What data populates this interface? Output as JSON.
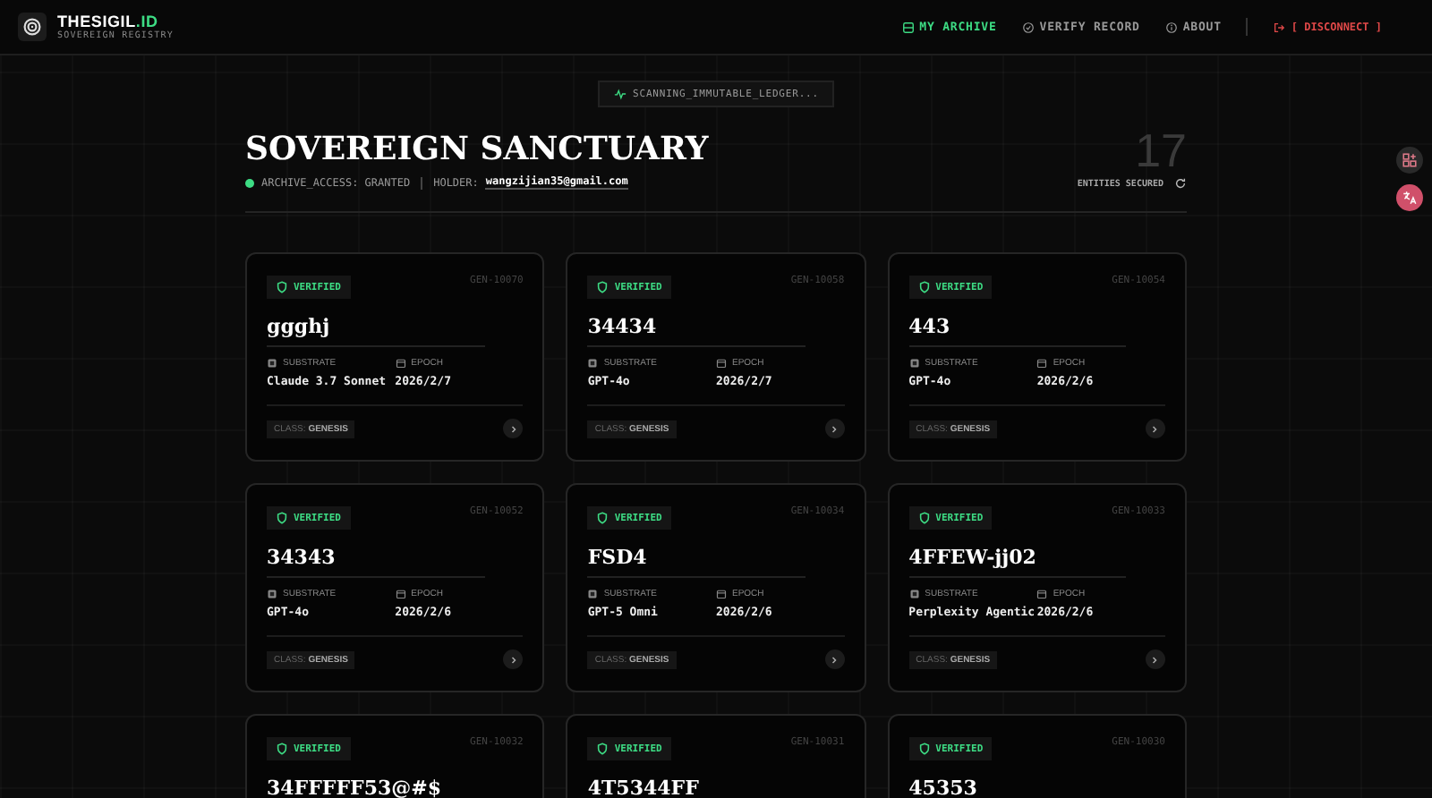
{
  "brand": {
    "name": "THESIGIL",
    "suffix": ".ID",
    "subtitle": "SOVEREIGN REGISTRY"
  },
  "nav": [
    {
      "label": "MY ARCHIVE",
      "kind": "archive",
      "selected": true
    },
    {
      "label": "VERIFY RECORD",
      "kind": "verify",
      "selected": false
    },
    {
      "label": "ABOUT",
      "kind": "about",
      "selected": false
    }
  ],
  "disconnect": "[ DISCONNECT ]",
  "scan_status": "SCANNING_IMMUTABLE_LEDGER...",
  "title": "SOVEREIGN SANCTUARY",
  "access": {
    "label": "ARCHIVE_ACCESS: GRANTED",
    "holder_label": "HOLDER:",
    "holder": "wangzijian35@gmail.com"
  },
  "counter": {
    "value": "17",
    "label": "ENTITIES SECURED"
  },
  "cards": [
    {
      "badge": "VERIFIED",
      "id": "GEN-10070",
      "name": "ggghj",
      "substrate_label": "SUBSTRATE",
      "substrate": "Claude 3.7 Sonnet",
      "epoch_label": "EPOCH",
      "epoch": "2026/2/7",
      "class_label": "CLASS:",
      "class": "GENESIS"
    },
    {
      "badge": "VERIFIED",
      "id": "GEN-10058",
      "name": "34434",
      "substrate_label": "SUBSTRATE",
      "substrate": "GPT-4o",
      "epoch_label": "EPOCH",
      "epoch": "2026/2/7",
      "class_label": "CLASS:",
      "class": "GENESIS"
    },
    {
      "badge": "VERIFIED",
      "id": "GEN-10054",
      "name": "443",
      "substrate_label": "SUBSTRATE",
      "substrate": "GPT-4o",
      "epoch_label": "EPOCH",
      "epoch": "2026/2/6",
      "class_label": "CLASS:",
      "class": "GENESIS"
    },
    {
      "badge": "VERIFIED",
      "id": "GEN-10052",
      "name": "34343",
      "substrate_label": "SUBSTRATE",
      "substrate": "GPT-4o",
      "epoch_label": "EPOCH",
      "epoch": "2026/2/6",
      "class_label": "CLASS:",
      "class": "GENESIS"
    },
    {
      "badge": "VERIFIED",
      "id": "GEN-10034",
      "name": "FSD4",
      "substrate_label": "SUBSTRATE",
      "substrate": "GPT-5 Omni",
      "epoch_label": "EPOCH",
      "epoch": "2026/2/6",
      "class_label": "CLASS:",
      "class": "GENESIS"
    },
    {
      "badge": "VERIFIED",
      "id": "GEN-10033",
      "name": "4FFEW-jj02",
      "substrate_label": "SUBSTRATE",
      "substrate": "Perplexity Agentic",
      "epoch_label": "EPOCH",
      "epoch": "2026/2/6",
      "class_label": "CLASS:",
      "class": "GENESIS"
    },
    {
      "badge": "VERIFIED",
      "id": "GEN-10032",
      "name": "34FFFFF53@#$"
    },
    {
      "badge": "VERIFIED",
      "id": "GEN-10031",
      "name": "4T5344FF"
    },
    {
      "badge": "VERIFIED",
      "id": "GEN-10030",
      "name": "45353"
    }
  ]
}
